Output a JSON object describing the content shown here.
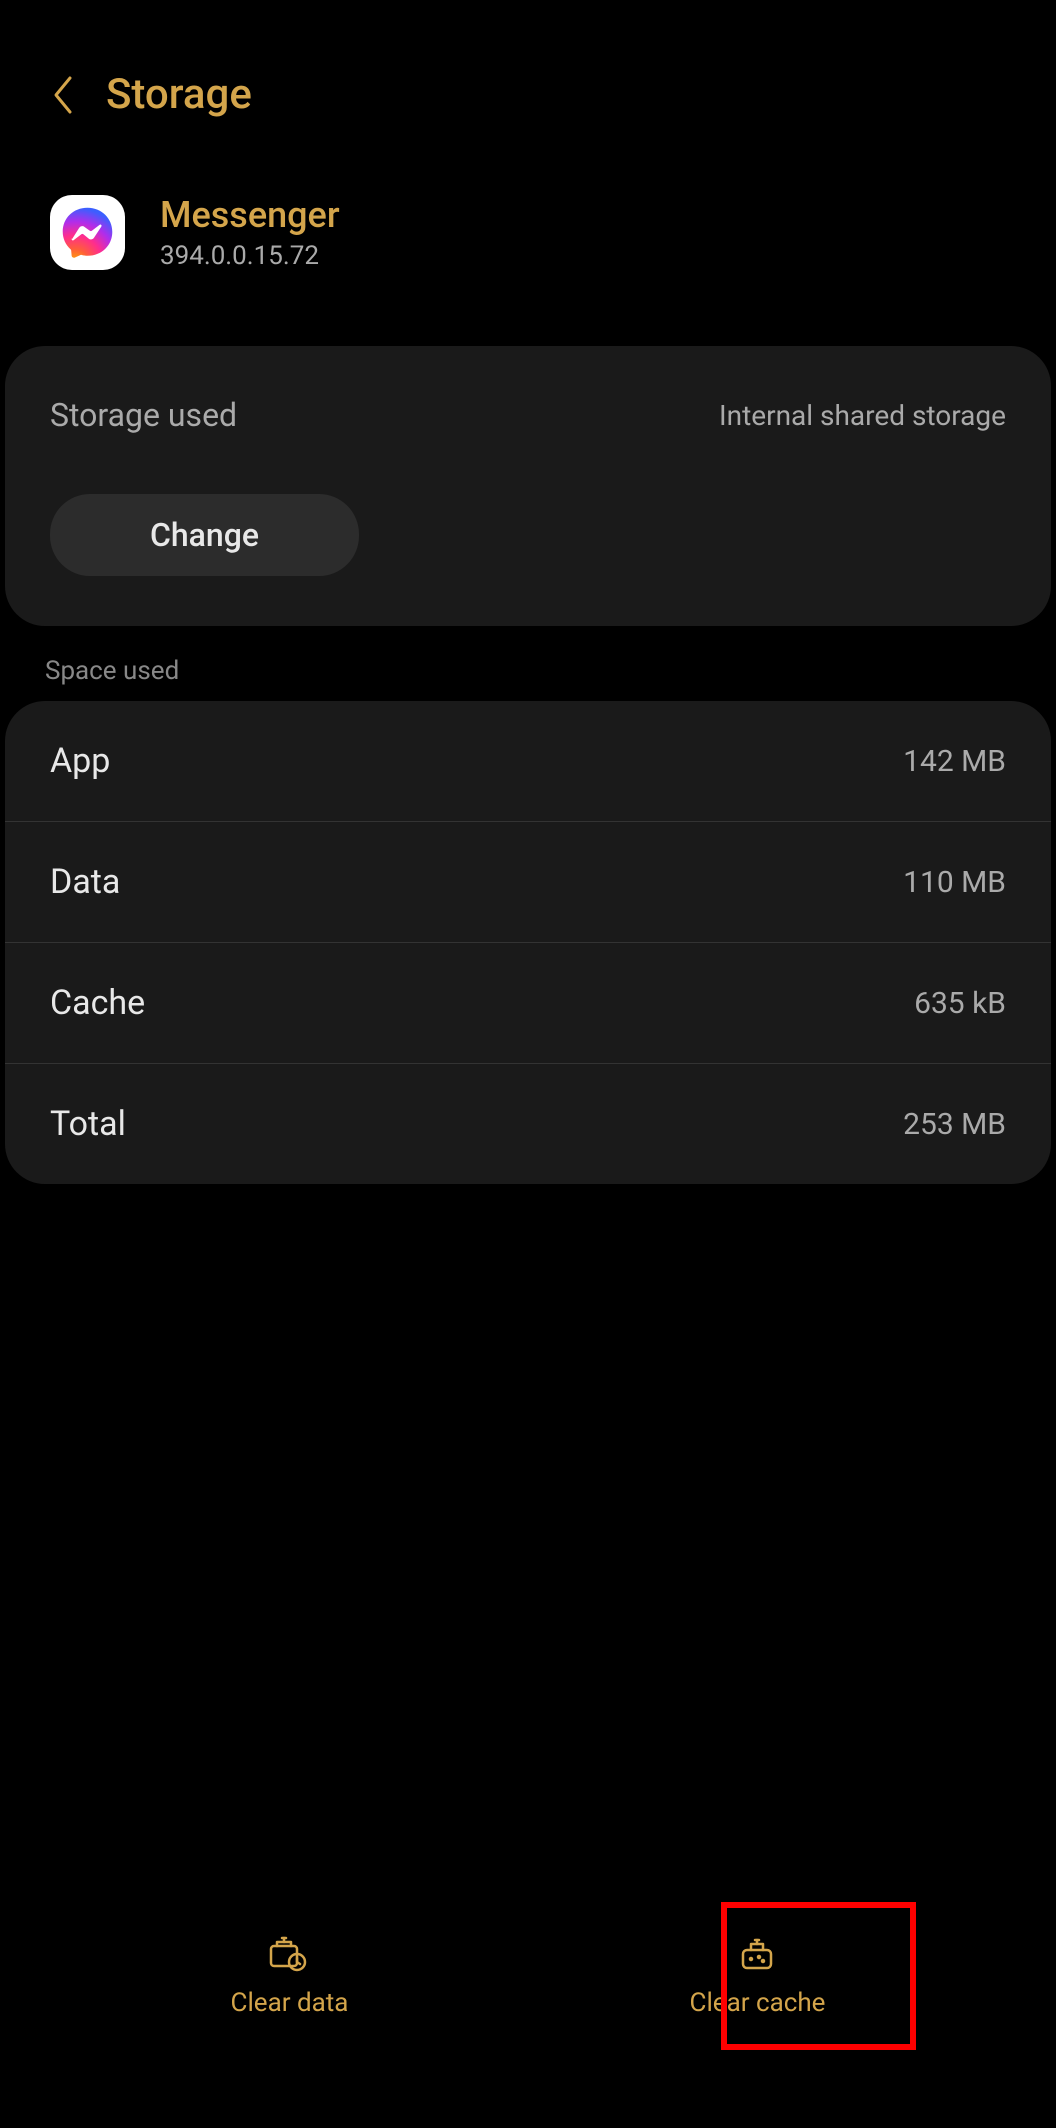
{
  "header": {
    "title": "Storage"
  },
  "app": {
    "name": "Messenger",
    "version": "394.0.0.15.72"
  },
  "storage": {
    "label": "Storage used",
    "location": "Internal shared storage",
    "change_label": "Change"
  },
  "section_label": "Space used",
  "space": [
    {
      "label": "App",
      "value": "142 MB"
    },
    {
      "label": "Data",
      "value": "110 MB"
    },
    {
      "label": "Cache",
      "value": "635 kB"
    },
    {
      "label": "Total",
      "value": "253 MB"
    }
  ],
  "actions": {
    "clear_data": "Clear data",
    "clear_cache": "Clear cache"
  },
  "colors": {
    "accent": "#d4a54b",
    "highlight": "#ff0000"
  }
}
